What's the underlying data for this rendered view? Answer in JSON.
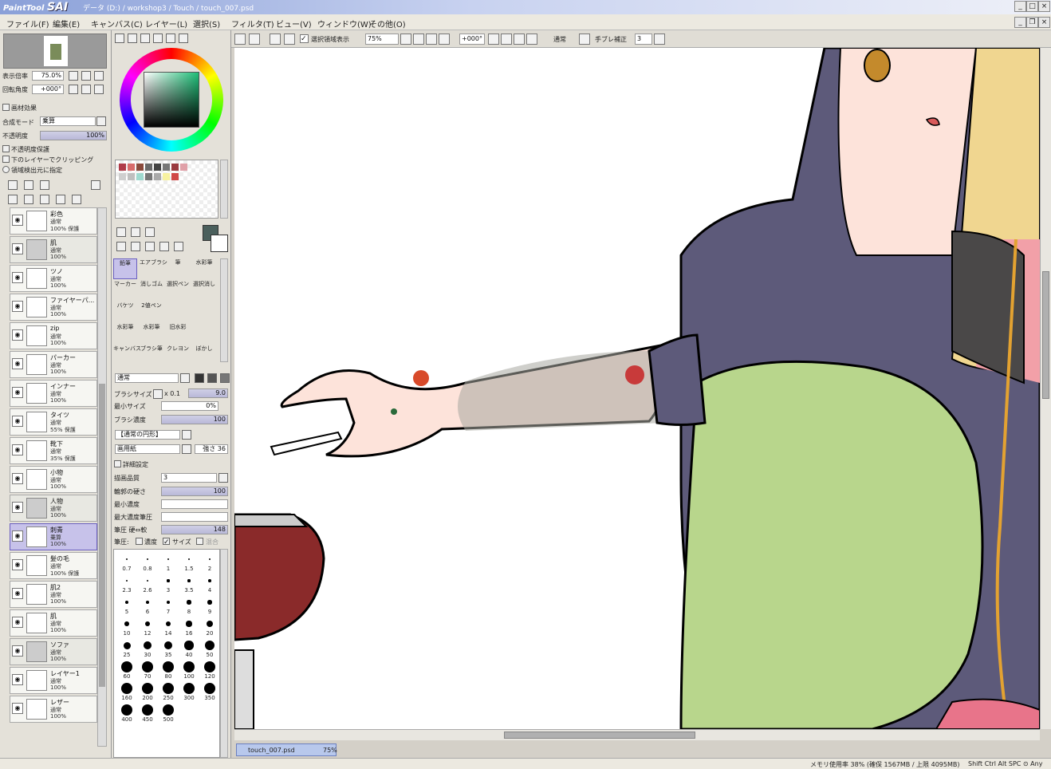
{
  "title": {
    "app_name": "PaintTool SAI",
    "path": "データ (D:) / workshop3 / Touch / touch_007.psd"
  },
  "menu": [
    "ファイル(F)",
    "編集(E)",
    "キャンバス(C)",
    "レイヤー(L)",
    "選択(S)",
    "フィルタ(T)",
    "ビュー(V)",
    "ウィンドウ(W)",
    "その他(O)"
  ],
  "toolbar": {
    "selection_check_label": "選択領域表示",
    "zoom": "75%",
    "rotation": "+000°",
    "blend": "通常",
    "stabilizer_label": "手ブレ補正",
    "stabilizer_value": "3"
  },
  "navigator": {
    "zoom_label": "表示倍率",
    "zoom_value": "75.0%",
    "angle_label": "回転角度",
    "angle_value": "+000°"
  },
  "layer_props": {
    "paper_effect": "画材効果",
    "blend_label": "合成モード",
    "blend_value": "乗算",
    "opacity_label": "不透明度",
    "opacity_value": "100%",
    "protect_alpha": "不透明度保護",
    "clip_lower": "下のレイヤーでクリッピング",
    "selection_source": "領域検出元に指定"
  },
  "layers": [
    {
      "name": "彩色",
      "mode": "通常",
      "op": "100% 保護",
      "type": "layer"
    },
    {
      "name": "肌",
      "mode": "通常",
      "op": "100%",
      "type": "folder"
    },
    {
      "name": "ツノ",
      "mode": "通常",
      "op": "100%",
      "type": "layer"
    },
    {
      "name": "ファイヤーパ...",
      "mode": "通常",
      "op": "100%",
      "type": "layer"
    },
    {
      "name": "zip",
      "mode": "通常",
      "op": "100%",
      "type": "layer"
    },
    {
      "name": "パーカー",
      "mode": "通常",
      "op": "100%",
      "type": "layer"
    },
    {
      "name": "インナー",
      "mode": "通常",
      "op": "100%",
      "type": "layer"
    },
    {
      "name": "タイツ",
      "mode": "通常",
      "op": "55% 保護",
      "type": "layer"
    },
    {
      "name": "靴下",
      "mode": "通常",
      "op": "35% 保護",
      "type": "layer"
    },
    {
      "name": "小物",
      "mode": "通常",
      "op": "100%",
      "type": "layer"
    },
    {
      "name": "人物",
      "mode": "通常",
      "op": "100%",
      "type": "folder"
    },
    {
      "name": "刺青",
      "mode": "乗算",
      "op": "100%",
      "type": "selected"
    },
    {
      "name": "髪の毛",
      "mode": "通常",
      "op": "100% 保護",
      "type": "layer"
    },
    {
      "name": "肌2",
      "mode": "通常",
      "op": "100%",
      "type": "layer"
    },
    {
      "name": "肌",
      "mode": "通常",
      "op": "100%",
      "type": "layer"
    },
    {
      "name": "ソファ",
      "mode": "通常",
      "op": "100%",
      "type": "folder"
    },
    {
      "name": "レイヤー1",
      "mode": "通常",
      "op": "100%",
      "type": "layer"
    },
    {
      "name": "レザー",
      "mode": "通常",
      "op": "100%",
      "type": "layer"
    }
  ],
  "tools": [
    {
      "label": "鉛筆",
      "selected": true
    },
    {
      "label": "エアブラシ",
      "selected": false
    },
    {
      "label": "筆",
      "selected": false
    },
    {
      "label": "水彩筆",
      "selected": false
    },
    {
      "label": "マーカー",
      "selected": false
    },
    {
      "label": "消しゴム",
      "selected": false
    },
    {
      "label": "選択ペン",
      "selected": false
    },
    {
      "label": "選択消し",
      "selected": false
    },
    {
      "label": "バケツ",
      "selected": false
    },
    {
      "label": "2値ペン",
      "selected": false
    },
    {
      "label": "",
      "selected": false
    },
    {
      "label": "",
      "selected": false
    },
    {
      "label": "水彩筆",
      "selected": false
    },
    {
      "label": "水彩筆",
      "selected": false
    },
    {
      "label": "旧水彩",
      "selected": false
    },
    {
      "label": "",
      "selected": false
    },
    {
      "label": "キャンバス",
      "selected": false
    },
    {
      "label": "ブラシ筆",
      "selected": false
    },
    {
      "label": "クレヨン",
      "selected": false
    },
    {
      "label": "ぼかし",
      "selected": false
    }
  ],
  "brush": {
    "mode": "通常",
    "size_label": "ブラシサイズ",
    "size_mult": "x 0.1",
    "size_value": "9.0",
    "min_size_label": "最小サイズ",
    "min_size_value": "0%",
    "density_label": "ブラシ濃度",
    "density_value": "100",
    "shape_label": "【通常の円形】",
    "texture_label": "画用紙",
    "texture_strength": "強さ 36",
    "advanced_label": "詳細設定",
    "quality_label": "描画品質",
    "quality_value": "3",
    "edge_label": "輪郭の硬さ",
    "edge_value": "100",
    "min_density_label": "最小濃度",
    "max_pressure_label": "最大濃度筆圧",
    "pressure_label": "筆圧 硬⇔軟",
    "pressure_value": "148",
    "pressure_opts": "筆圧:",
    "pressure_density": "濃度",
    "pressure_size": "サイズ",
    "pressure_blend": "混合"
  },
  "brush_sizes": [
    "0.7",
    "0.8",
    "1",
    "1.5",
    "2",
    "2.3",
    "2.6",
    "3",
    "3.5",
    "4",
    "5",
    "6",
    "7",
    "8",
    "9",
    "10",
    "12",
    "14",
    "16",
    "20",
    "25",
    "30",
    "35",
    "40",
    "50",
    "60",
    "70",
    "80",
    "100",
    "120",
    "160",
    "200",
    "250",
    "300",
    "350",
    "400",
    "450",
    "500"
  ],
  "doc_tab": {
    "name": "touch_007.psd",
    "zoom": "75%"
  },
  "status": {
    "memory": "メモリ使用率 38% (確保 1567MB / 上限 4095MB)",
    "keys": "Shift Ctrl Alt SPC ⊙ Any"
  },
  "colors": {
    "accent": "#6a5fc0",
    "hoodie": "#5d5a7a",
    "pillow": "#b8d68c",
    "skin": "#fde3da",
    "current_color": "#4a5f5c"
  }
}
